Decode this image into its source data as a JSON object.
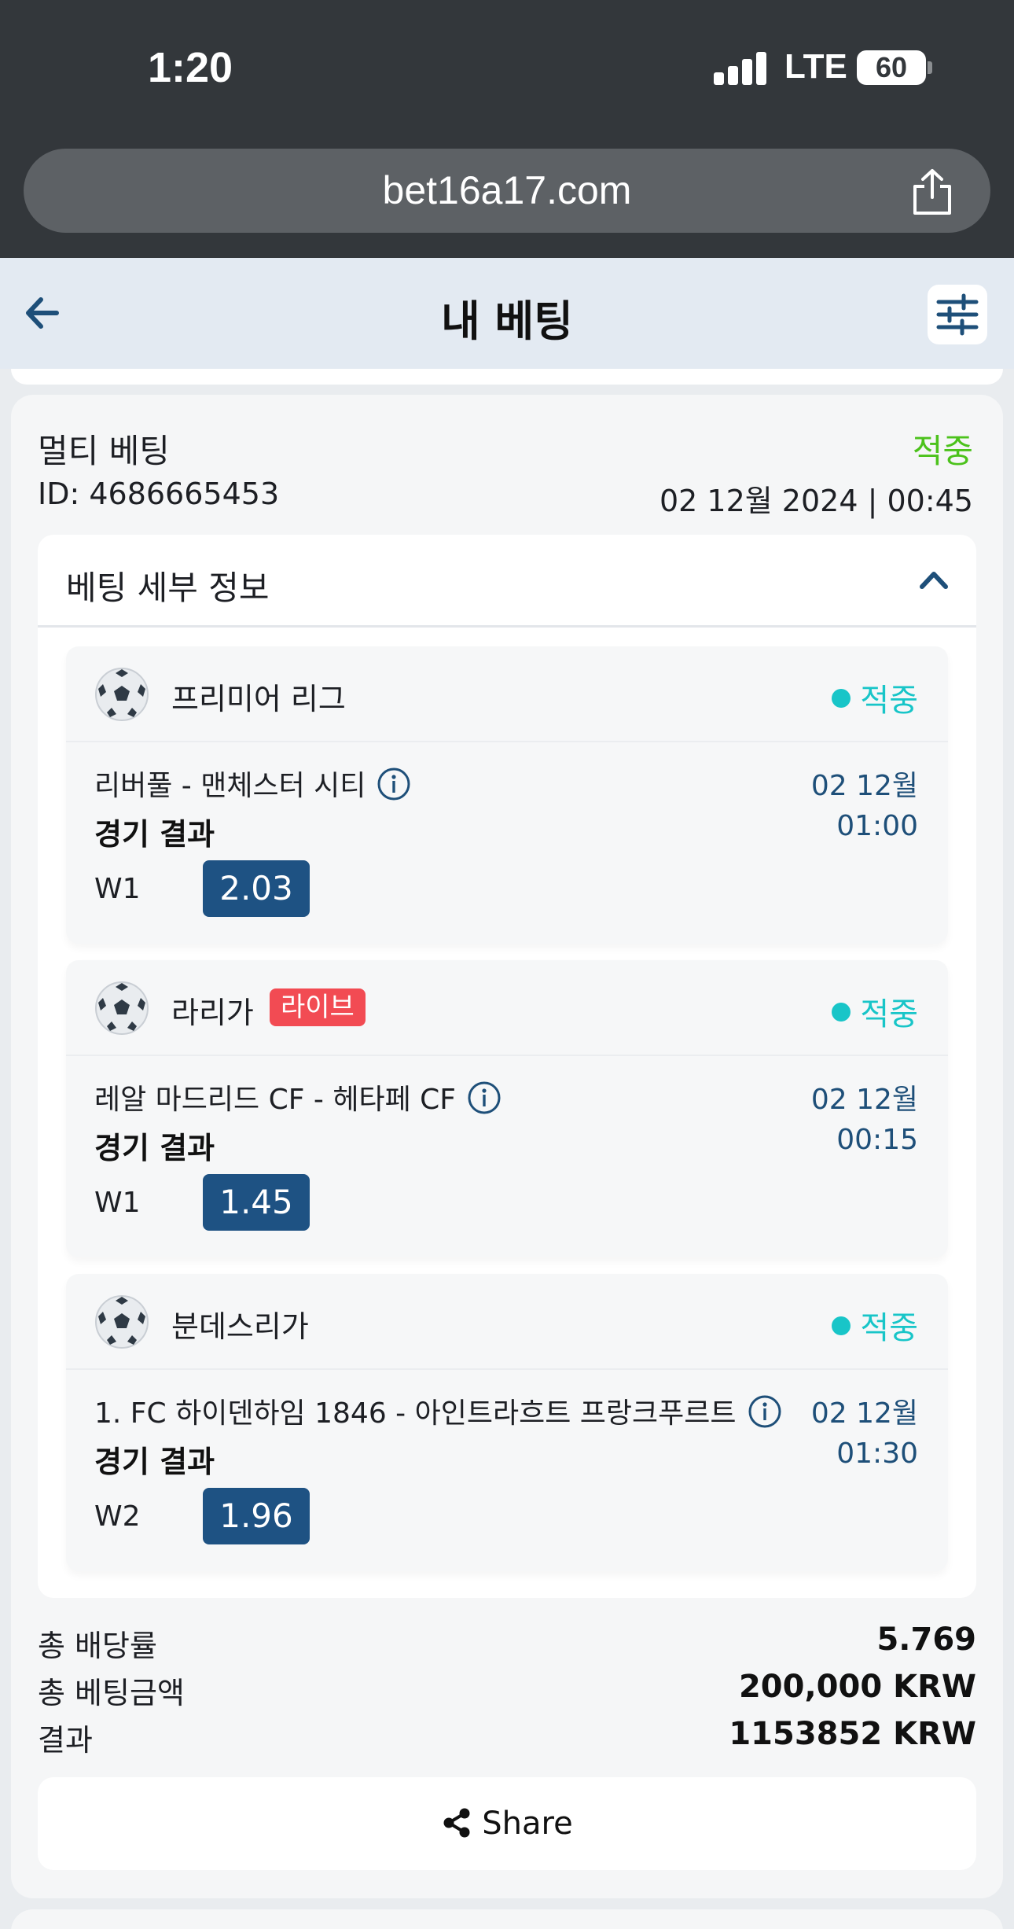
{
  "status_bar": {
    "time": "1:20",
    "network": "LTE",
    "battery": "60"
  },
  "browser": {
    "url": "bet16a17.com"
  },
  "header": {
    "title": "내 베팅"
  },
  "bet": {
    "type": "멀티 베팅",
    "status": "적중",
    "id": "ID: 4686665453",
    "date": "02 12월 2024 | 00:45",
    "details_title": "베팅 세부 정보",
    "events": [
      {
        "league": "프리미어 리그",
        "live": "",
        "status": "적중",
        "match": "리버풀 - 맨체스터 시티",
        "market": "경기 결과",
        "date": "02 12월",
        "time": "01:00",
        "pick": "W1",
        "odds": "2.03"
      },
      {
        "league": "라리가",
        "live": "라이브",
        "status": "적중",
        "match": "레알 마드리드 CF - 헤타페 CF",
        "market": "경기 결과",
        "date": "02 12월",
        "time": "00:15",
        "pick": "W1",
        "odds": "1.45"
      },
      {
        "league": "분데스리가",
        "live": "",
        "status": "적중",
        "match": "1. FC 하이덴하임 1846 - 아인트라흐트 프랑크푸르트",
        "market": "경기 결과",
        "date": "02 12월",
        "time": "01:30",
        "pick": "W2",
        "odds": "1.96"
      }
    ],
    "summary": [
      {
        "label": "총 배당률",
        "value": "5.769"
      },
      {
        "label": "총 베팅금액",
        "value": "200,000 KRW"
      },
      {
        "label": "결과",
        "value": "1153852 KRW"
      }
    ],
    "share_label": "Share"
  },
  "colors": {
    "win_green": "#4cc21c",
    "status_teal": "#18c5c8",
    "odds_blue": "#1e5283",
    "live_red": "#f24b53"
  }
}
